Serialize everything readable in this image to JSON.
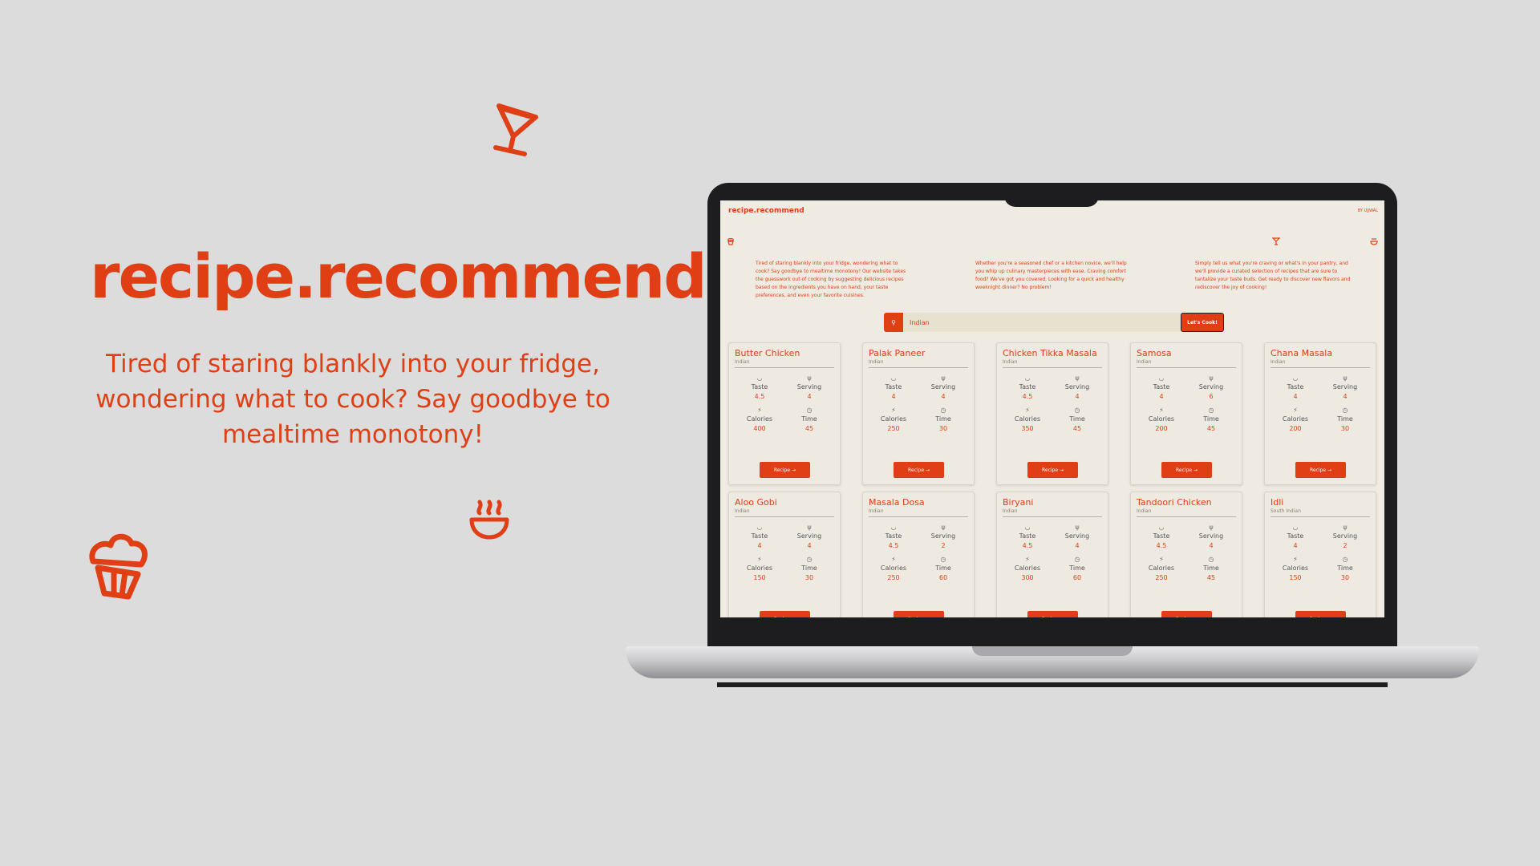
{
  "hero": {
    "title": "recipe.recommend",
    "subtitle": "Tired of staring blankly into your fridge, wondering what to cook? Say goodbye to mealtime monotony!"
  },
  "colors": {
    "accent": "#e03e14",
    "background": "#dcdcdc",
    "screen": "#efebe3"
  },
  "icons": [
    "cocktail-icon",
    "cupcake-icon",
    "steaming-bowl-icon"
  ],
  "app": {
    "brand": "recipe.recommend",
    "byline": "BY UJJWAL",
    "paragraphs": [
      "Tired of staring blankly into your fridge, wondering what to cook? Say goodbye to mealtime monotony! Our website takes the guesswork out of cooking by suggesting delicious recipes based on the ingredients you have on hand, your taste preferences, and even your favorite cuisines.",
      "Whether you're a seasoned chef or a kitchen novice, we'll help you whip up culinary masterpieces with ease. Craving comfort food? We've got you covered. Looking for a quick and healthy weeknight dinner? No problem!",
      "Simply tell us what you're craving or what's in your pantry, and we'll provide a curated selection of recipes that are sure to tantalize your taste buds. Get ready to discover new flavors and rediscover the joy of cooking!"
    ],
    "search": {
      "icon": "search-icon",
      "value": "Indian",
      "button": "Let's Cook!"
    },
    "labels": {
      "taste": "Taste",
      "serving": "Serving",
      "calories": "Calories",
      "time": "Time",
      "recipe_button": "Recipe →"
    },
    "recipes": [
      {
        "name": "Butter Chicken",
        "cuisine": "Indian",
        "taste": "4.5",
        "serving": "4",
        "calories": "400",
        "time": "45"
      },
      {
        "name": "Palak Paneer",
        "cuisine": "Indian",
        "taste": "4",
        "serving": "4",
        "calories": "250",
        "time": "30"
      },
      {
        "name": "Chicken Tikka Masala",
        "cuisine": "Indian",
        "taste": "4.5",
        "serving": "4",
        "calories": "350",
        "time": "45"
      },
      {
        "name": "Samosa",
        "cuisine": "Indian",
        "taste": "4",
        "serving": "6",
        "calories": "200",
        "time": "45"
      },
      {
        "name": "Chana Masala",
        "cuisine": "Indian",
        "taste": "4",
        "serving": "4",
        "calories": "200",
        "time": "30"
      },
      {
        "name": "Aloo Gobi",
        "cuisine": "Indian",
        "taste": "4",
        "serving": "4",
        "calories": "150",
        "time": "30"
      },
      {
        "name": "Masala Dosa",
        "cuisine": "Indian",
        "taste": "4.5",
        "serving": "2",
        "calories": "250",
        "time": "60"
      },
      {
        "name": "Biryani",
        "cuisine": "Indian",
        "taste": "4.5",
        "serving": "4",
        "calories": "300",
        "time": "60"
      },
      {
        "name": "Tandoori Chicken",
        "cuisine": "Indian",
        "taste": "4.5",
        "serving": "4",
        "calories": "250",
        "time": "45"
      },
      {
        "name": "Idli",
        "cuisine": "South Indian",
        "taste": "4",
        "serving": "2",
        "calories": "150",
        "time": "30"
      }
    ]
  }
}
